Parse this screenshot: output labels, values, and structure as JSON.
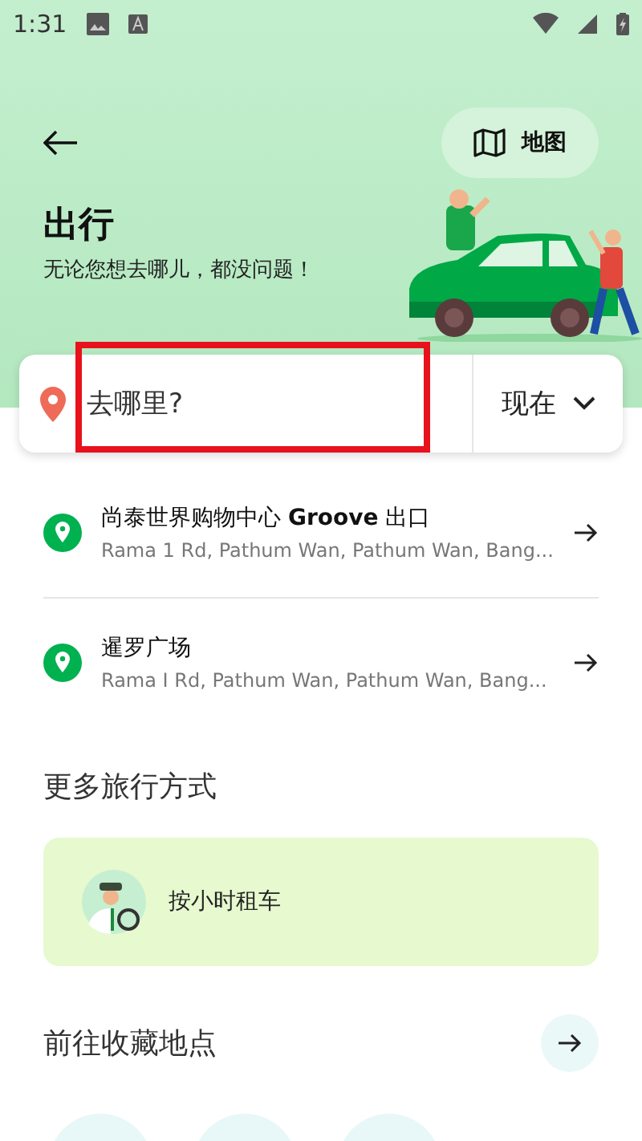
{
  "status_bar": {
    "time": "1:31"
  },
  "header": {
    "map_button": "地图",
    "title": "出行",
    "subtitle": "无论您想去哪儿，都没问题！"
  },
  "search": {
    "placeholder": "去哪里?",
    "highlighted": true,
    "time_selector": "现在"
  },
  "recent_places": [
    {
      "name": "尚泰世界购物中心 **Groove** 出口",
      "address": "Rama 1 Rd, Pathum Wan, Pathum Wan, Bang..."
    },
    {
      "name": "暹罗广场",
      "address": "Rama I Rd, Pathum Wan, Pathum Wan, Bang..."
    }
  ],
  "more_options": {
    "title": "更多旅行方式",
    "items": [
      {
        "label": "按小时租车"
      }
    ]
  },
  "saved_places": {
    "title": "前往收藏地点"
  }
}
